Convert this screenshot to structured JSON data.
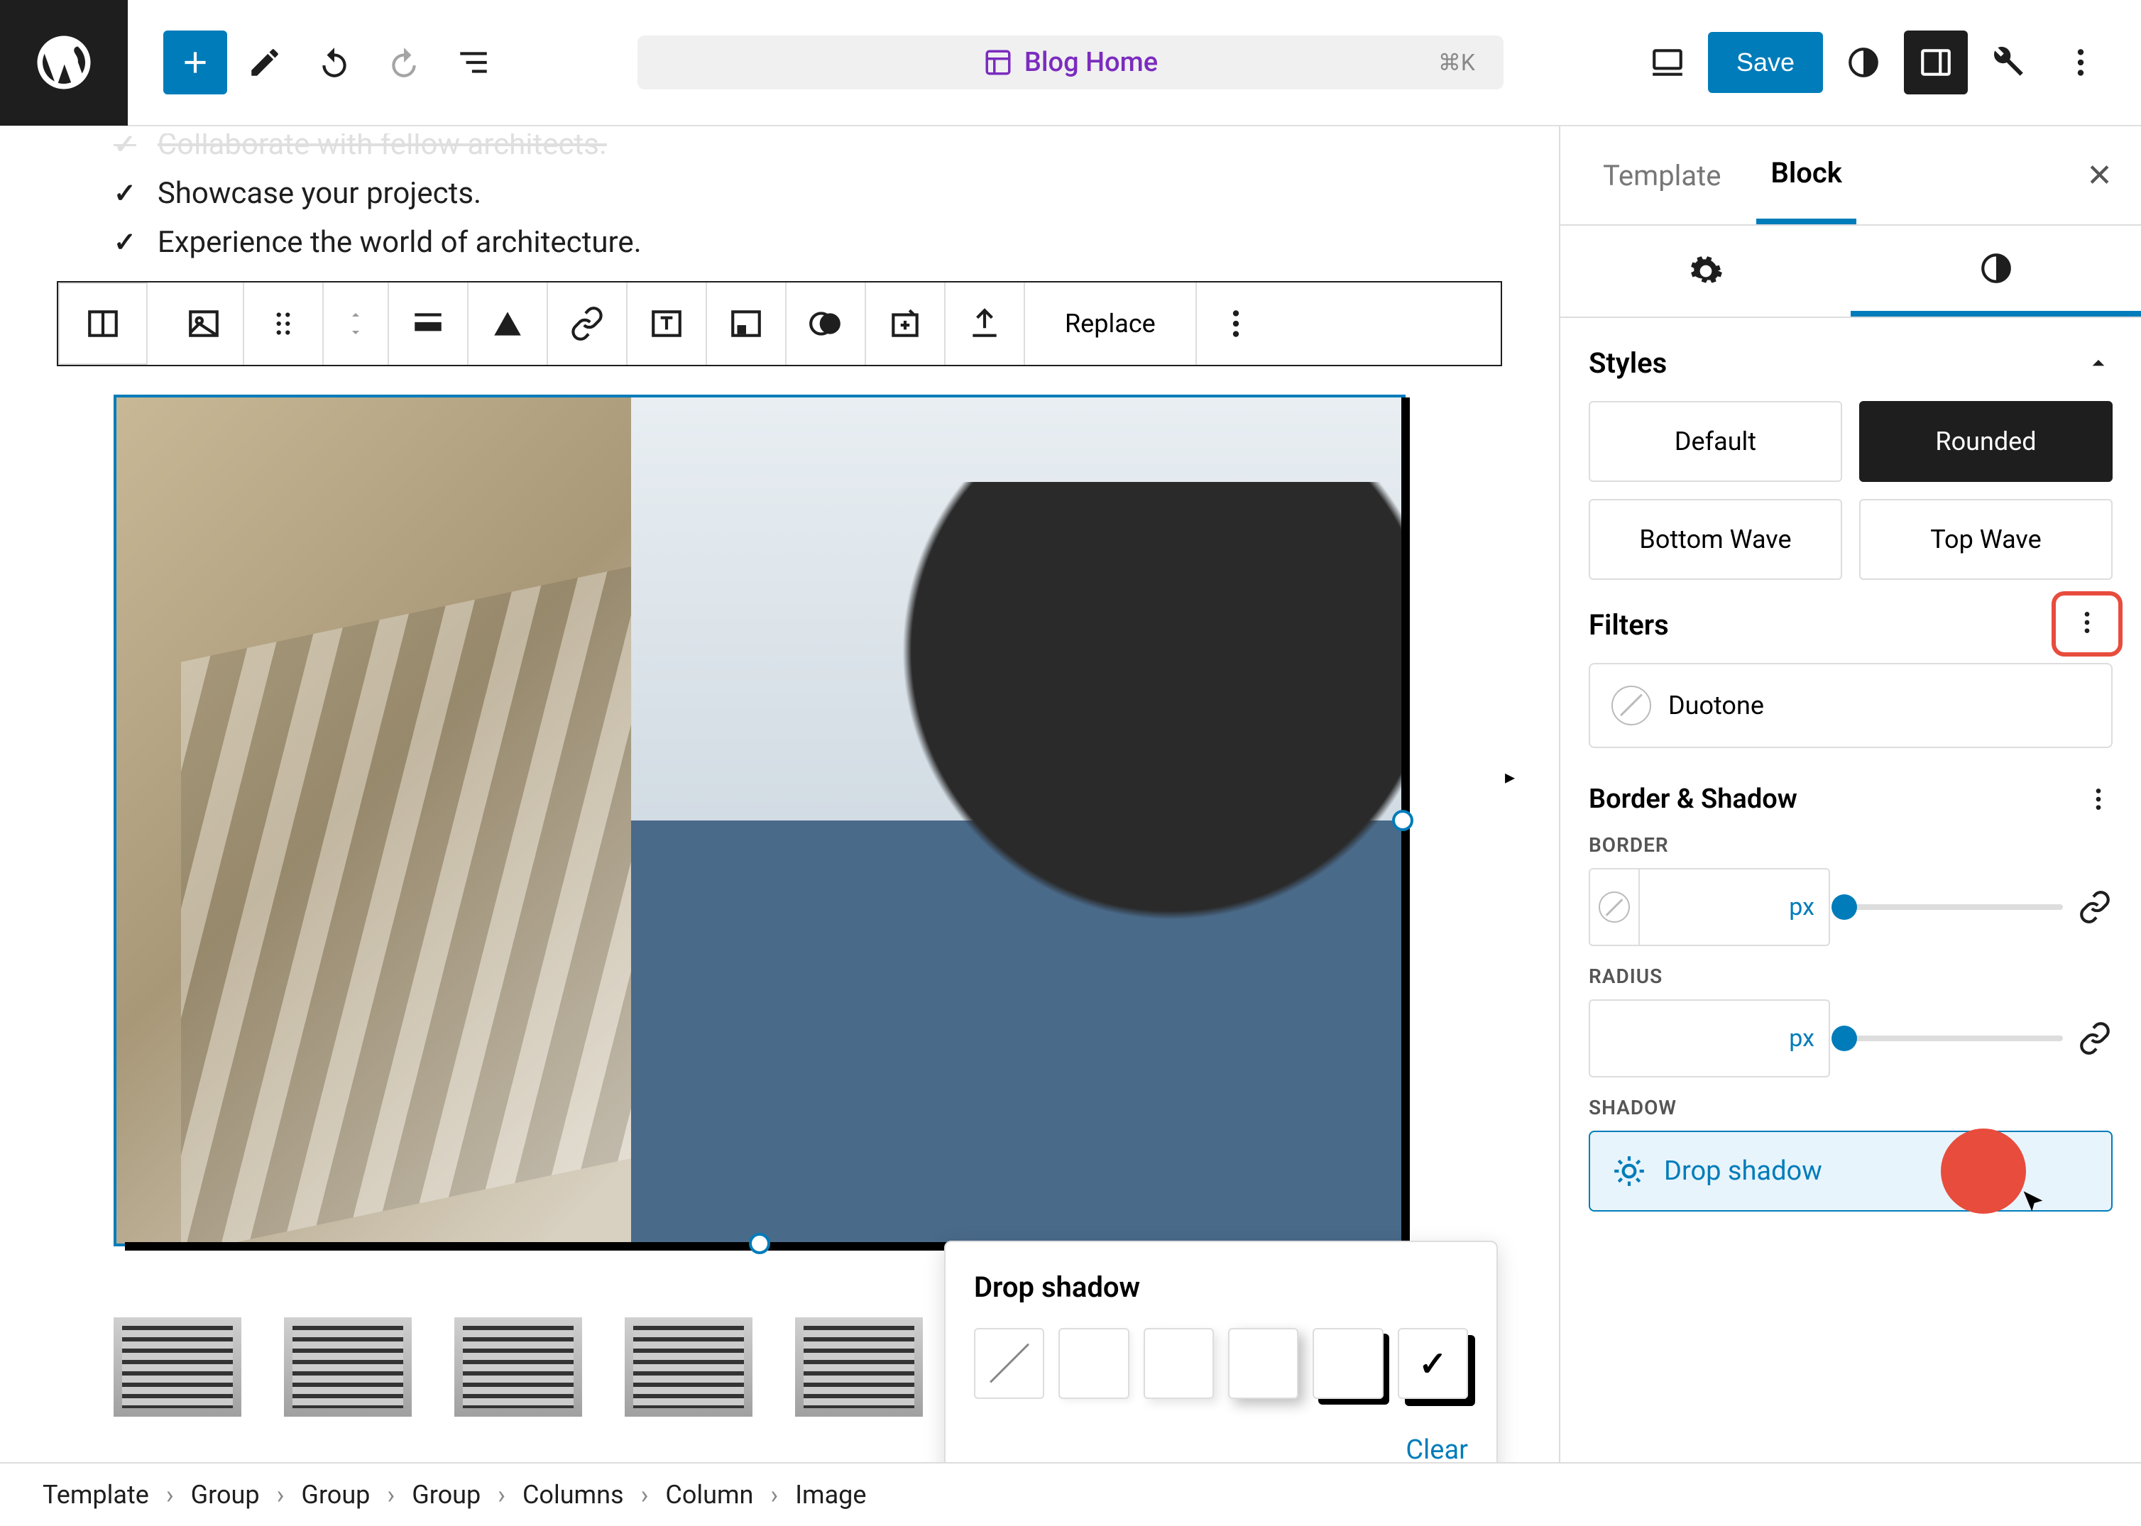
{
  "topbar": {
    "doc_title": "Blog Home",
    "kbd": "⌘K",
    "save": "Save"
  },
  "canvas": {
    "list": [
      "Collaborate with fellow architects.",
      "Showcase your projects.",
      "Experience the world of architecture."
    ],
    "replace": "Replace"
  },
  "popover": {
    "title": "Drop shadow",
    "clear": "Clear"
  },
  "sidebar": {
    "tabs": {
      "template": "Template",
      "block": "Block"
    },
    "styles": {
      "title": "Styles",
      "options": [
        "Default",
        "Rounded",
        "Bottom Wave",
        "Top Wave"
      ],
      "active": "Rounded"
    },
    "filters": {
      "title": "Filters",
      "duotone": "Duotone"
    },
    "border_shadow": {
      "title": "Border & Shadow",
      "border_label": "BORDER",
      "radius_label": "RADIUS",
      "shadow_label": "SHADOW",
      "unit": "px",
      "drop_shadow": "Drop shadow"
    }
  },
  "breadcrumb": [
    "Template",
    "Group",
    "Group",
    "Group",
    "Columns",
    "Column",
    "Image"
  ]
}
